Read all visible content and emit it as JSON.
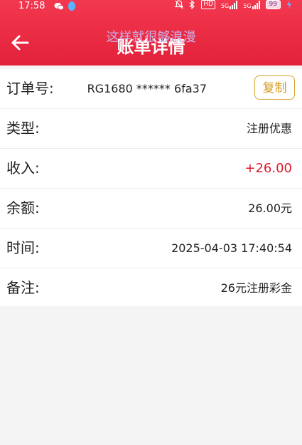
{
  "status_bar": {
    "time": "17:58",
    "hd_label": "HD",
    "signal1_label": "5G",
    "signal2_label": "5G",
    "battery": "99",
    "icons": [
      "wechat-icon",
      "qq-icon",
      "mute-icon",
      "bluetooth-icon",
      "charging-icon"
    ]
  },
  "header": {
    "title": "账单详情",
    "watermark": "这样就很够浪漫",
    "back_icon": "arrow-left-icon",
    "background": "#e8283f"
  },
  "details": {
    "order": {
      "label": "订单号:",
      "value": "RG1680 ****** 6fa37",
      "copy_label": "复制"
    },
    "type": {
      "label": "类型:",
      "value": "注册优惠"
    },
    "income": {
      "label": "收入:",
      "value": "+26.00",
      "color": "#e1182c"
    },
    "balance": {
      "label": "余额:",
      "value": "26.00元"
    },
    "time": {
      "label": "时间:",
      "value": "2025-04-03 17:40:54"
    },
    "remark": {
      "label": "备注:",
      "value": "26元注册彩金"
    }
  }
}
